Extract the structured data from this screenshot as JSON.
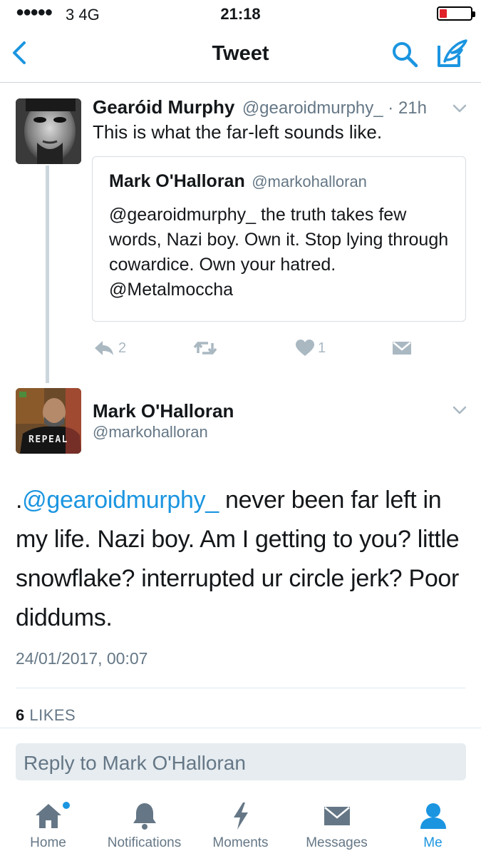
{
  "status_bar": {
    "signal": "●●●●●",
    "carrier": "3  4G",
    "time": "21:18"
  },
  "nav": {
    "title": "Tweet"
  },
  "tweet1": {
    "author_name": "Gearóid Murphy",
    "author_handle": "@gearoidmurphy_",
    "age": " · 21h",
    "text": "This is what the far-left sounds like.",
    "quote": {
      "author_name": "Mark O'Halloran",
      "author_handle": "@markohalloran",
      "text": "@gearoidmurphy_ the truth takes few words, Nazi boy. Own it. Stop lying through cowardice. Own your hatred. @Metalmoccha"
    },
    "reply_count": "2",
    "like_count": "1"
  },
  "tweet2": {
    "author_name": "Mark O'Halloran",
    "author_handle": "@markohalloran",
    "avatar_shirt_text": "REPEAL",
    "mention_prefix": ".",
    "mention": "@gearoidmurphy_",
    "text": " never been far left in my life. Nazi boy. Am I getting to you? little snowflake? interrupted ur circle jerk? Poor diddums.",
    "timestamp": "24/01/2017, 00:07",
    "likes_count": "6",
    "likes_label": " LIKES"
  },
  "reply": {
    "placeholder": "Reply to Mark O'Halloran"
  },
  "tabs": [
    {
      "label": "Home",
      "icon": "home-icon"
    },
    {
      "label": "Notifications",
      "icon": "bell-icon"
    },
    {
      "label": "Moments",
      "icon": "lightning-icon"
    },
    {
      "label": "Messages",
      "icon": "envelope-icon"
    },
    {
      "label": "Me",
      "icon": "person-icon"
    }
  ],
  "colors": {
    "accent": "#1b95e0",
    "muted": "#657786",
    "action_gray": "#aab8c2",
    "battery_low": "#e0222b"
  }
}
